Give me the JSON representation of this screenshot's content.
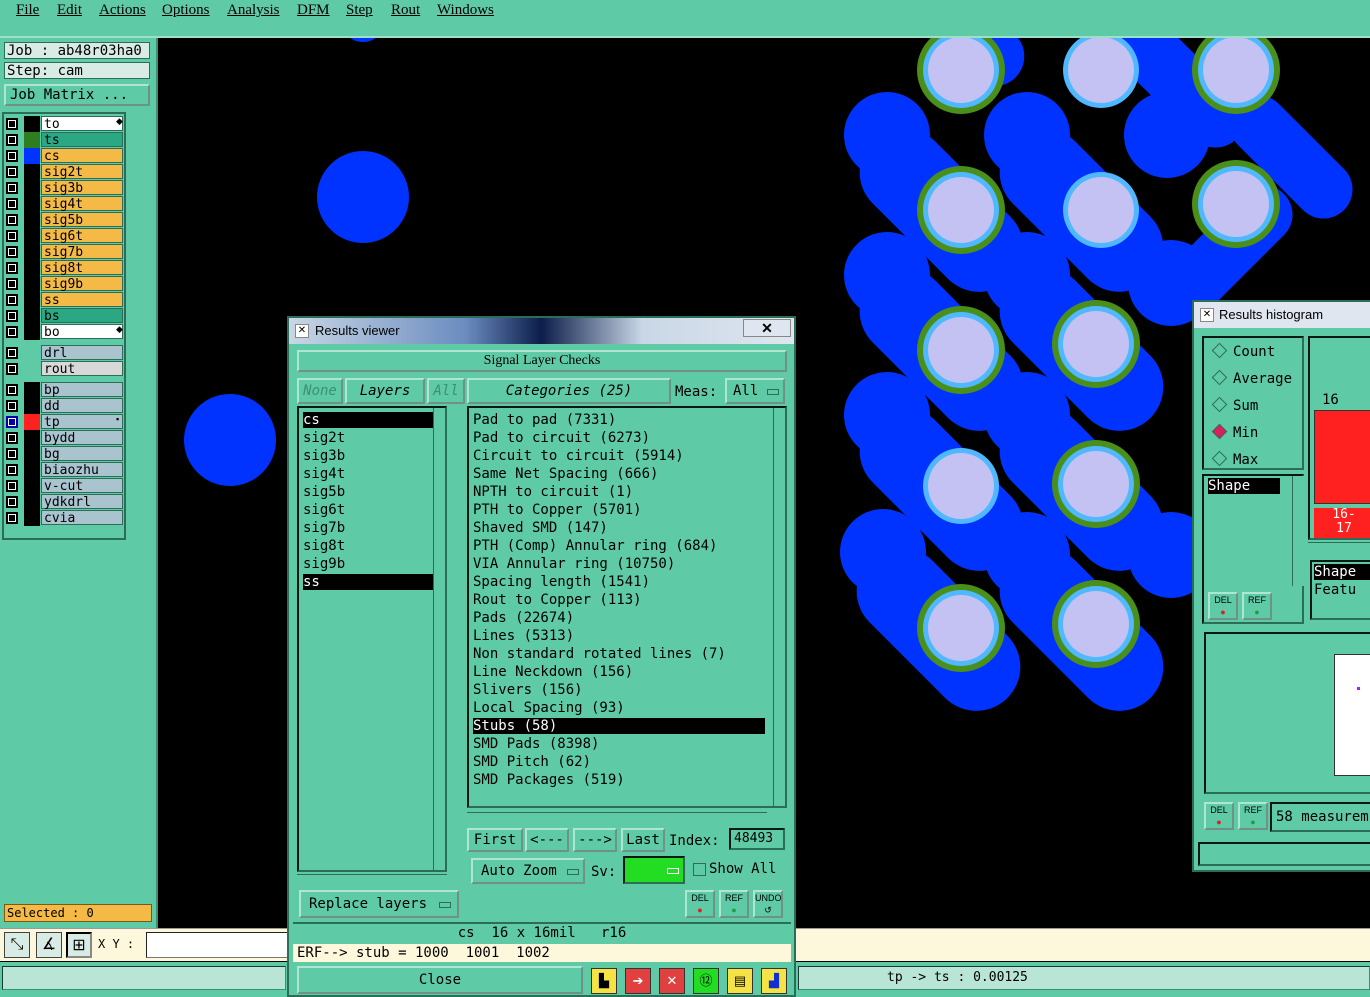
{
  "menu": [
    "File",
    "Edit",
    "Actions",
    "Options",
    "Analysis",
    "DFM",
    "Step",
    "Rout",
    "Windows"
  ],
  "job": {
    "label": "Job : ab48r03ha0",
    "step": "Step: cam",
    "matrix_button": "Job Matrix ..."
  },
  "layers": [
    {
      "name": "to",
      "color": "#000000",
      "bg": "#ffffff",
      "marker": true
    },
    {
      "name": "ts",
      "color": "#2e7d1f",
      "bg": "#2aa884"
    },
    {
      "name": "cs",
      "color": "#0033ff",
      "bg": "#f5b945"
    },
    {
      "name": "sig2t",
      "color": "#000000",
      "bg": "#f5b945"
    },
    {
      "name": "sig3b",
      "color": "#000000",
      "bg": "#f5b945"
    },
    {
      "name": "sig4t",
      "color": "#000000",
      "bg": "#f5b945"
    },
    {
      "name": "sig5b",
      "color": "#000000",
      "bg": "#f5b945"
    },
    {
      "name": "sig6t",
      "color": "#000000",
      "bg": "#f5b945"
    },
    {
      "name": "sig7b",
      "color": "#000000",
      "bg": "#f5b945"
    },
    {
      "name": "sig8t",
      "color": "#000000",
      "bg": "#f5b945"
    },
    {
      "name": "sig9b",
      "color": "#000000",
      "bg": "#f5b945"
    },
    {
      "name": "ss",
      "color": "#000000",
      "bg": "#f5b945"
    },
    {
      "name": "bs",
      "color": "#000000",
      "bg": "#2aa884"
    },
    {
      "name": "bo",
      "color": "#000000",
      "bg": "#ffffff",
      "marker": true
    }
  ],
  "drill_layers": [
    {
      "name": "drl",
      "bg": "#a9c4cf"
    },
    {
      "name": "rout",
      "bg": "#d8d8d8"
    }
  ],
  "misc_layers": [
    {
      "name": "bp",
      "color": "#000000",
      "bg": "#a9c4cf"
    },
    {
      "name": "dd",
      "color": "#000000",
      "bg": "#a9c4cf"
    },
    {
      "name": "tp",
      "color": "#ff2020",
      "bg": "#a9c4cf",
      "marker": true,
      "active": true
    },
    {
      "name": "bydd",
      "color": "#000000",
      "bg": "#a9c4cf"
    },
    {
      "name": "bg",
      "color": "#000000",
      "bg": "#a9c4cf"
    },
    {
      "name": "biaozhu",
      "color": "#000000",
      "bg": "#a9c4cf"
    },
    {
      "name": "v-cut",
      "color": "#000000",
      "bg": "#a9c4cf"
    },
    {
      "name": "ydkdrl",
      "color": "#000000",
      "bg": "#a9c4cf"
    },
    {
      "name": "cvia",
      "color": "#000000",
      "bg": "#a9c4cf"
    }
  ],
  "selected": "Selected : 0",
  "coord_label": "X Y :",
  "status_right": "tp -> ts : 0.00125",
  "results_viewer": {
    "title": "Results viewer",
    "close_x": "✕",
    "header": "Signal Layer Checks",
    "btn_none": "None",
    "btn_layers": "Layers",
    "btn_all": "All",
    "layers": [
      "cs",
      "sig2t",
      "sig3b",
      "sig4t",
      "sig5b",
      "sig6t",
      "sig7b",
      "sig8t",
      "sig9b",
      "ss"
    ],
    "selected_layers": [
      0,
      9
    ],
    "categories_label": "Categories  (25)",
    "meas_label": "Meas:",
    "meas_value": "All",
    "categories": [
      "Pad to pad (7331)",
      "Pad to circuit (6273)",
      "Circuit to circuit (5914)",
      "Same Net Spacing (666)",
      "NPTH to circuit (1)",
      "PTH to Copper (5701)",
      "Shaved SMD (147)",
      "PTH (Comp) Annular ring (684)",
      "VIA Annular ring (10750)",
      "Spacing length (1541)",
      "Rout to Copper (113)",
      "Pads (22674)",
      "Lines (5313)",
      "Non standard rotated lines (7)",
      "Line Neckdown (156)",
      "Slivers (156)",
      "Local Spacing (93)",
      "Stubs (58)",
      "SMD Pads (8398)",
      "SMD Pitch (62)",
      "SMD Packages (519)"
    ],
    "selected_category": 17,
    "nav": {
      "first": "First",
      "prev": "<---",
      "next": "--->",
      "last": "Last",
      "index_label": "Index:",
      "index_value": "48493"
    },
    "auto_zoom": "Auto Zoom",
    "sv_label": "Sv:",
    "show_all": "Show All",
    "replace_layers": "Replace layers",
    "del": "DEL",
    "ref": "REF",
    "undo": "UNDO",
    "info": "cs  16 x 16mil   r16",
    "erf": "ERF--> stub = 1000  1001  1002",
    "close": "Close"
  },
  "histogram": {
    "title": "Results histogram",
    "modes": [
      "Count",
      "Average",
      "Sum",
      "Min",
      "Max"
    ],
    "selected_mode": "Min",
    "list_item": "Shape",
    "bar_value": "16",
    "bar_label": "16-\n17",
    "shape_label": "Shape",
    "feature_label": "Featu",
    "del": "DEL",
    "ref": "REF",
    "measurements": "58 measurem"
  }
}
